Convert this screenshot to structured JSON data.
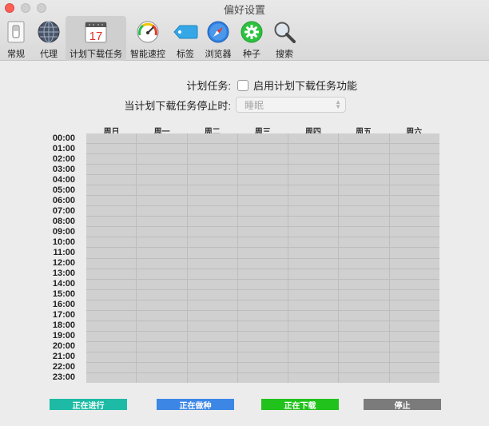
{
  "window": {
    "title": "偏好设置"
  },
  "toolbar": {
    "items": [
      {
        "label": "常规",
        "icon": "switch-icon"
      },
      {
        "label": "代理",
        "icon": "globe-icon"
      },
      {
        "label": "计划下载任务",
        "icon": "calendar-icon",
        "calendar_day": "17",
        "selected": true
      },
      {
        "label": "智能速控",
        "icon": "speedometer-icon"
      },
      {
        "label": "标签",
        "icon": "tag-icon"
      },
      {
        "label": "浏览器",
        "icon": "compass-icon"
      },
      {
        "label": "种子",
        "icon": "gear-icon"
      },
      {
        "label": "搜索",
        "icon": "magnifier-icon"
      }
    ]
  },
  "schedule": {
    "task_label": "计划任务:",
    "enable_checkbox": {
      "label": "启用计划下载任务功能",
      "checked": false
    },
    "stop_label": "当计划下载任务停止时:",
    "stop_select": {
      "value": "睡眠",
      "disabled": true
    }
  },
  "grid": {
    "days": [
      "周日",
      "周一",
      "周二",
      "周三",
      "周四",
      "周五",
      "周六"
    ],
    "hours": [
      "00:00",
      "01:00",
      "02:00",
      "03:00",
      "04:00",
      "05:00",
      "06:00",
      "07:00",
      "08:00",
      "09:00",
      "10:00",
      "11:00",
      "12:00",
      "13:00",
      "14:00",
      "15:00",
      "16:00",
      "17:00",
      "18:00",
      "19:00",
      "20:00",
      "21:00",
      "22:00",
      "23:00"
    ]
  },
  "legend": [
    {
      "label": "正在进行",
      "color": "#1dbba5"
    },
    {
      "label": "正在做种",
      "color": "#3c87e6"
    },
    {
      "label": "正在下载",
      "color": "#21c21b"
    },
    {
      "label": "停止",
      "color": "#7b7b7b"
    }
  ]
}
